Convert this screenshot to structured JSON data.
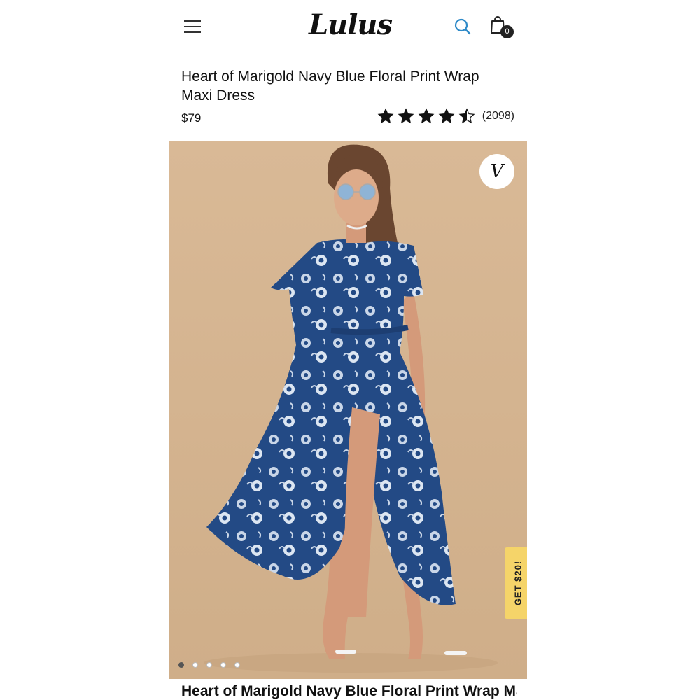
{
  "header": {
    "logo_text": "Lulus",
    "cart_count": "0"
  },
  "product": {
    "title": "Heart of Marigold Navy Blue Floral Print Wrap Maxi Dress",
    "price": "$79",
    "rating": 4.5,
    "review_count": "(2098)"
  },
  "gallery": {
    "favorite_glyph": "V",
    "total_images": 5,
    "active_index": 0
  },
  "promo": {
    "label": "GET $20!"
  },
  "colors": {
    "background": "#d6b491",
    "dress": "#234a85",
    "promo": "#f5d469",
    "search_icon": "#2e8ac8"
  },
  "icons": {
    "menu": "hamburger-menu-icon",
    "search": "search-icon",
    "bag": "shopping-bag-icon",
    "favorite": "heart-v-icon",
    "star": "star-icon"
  }
}
